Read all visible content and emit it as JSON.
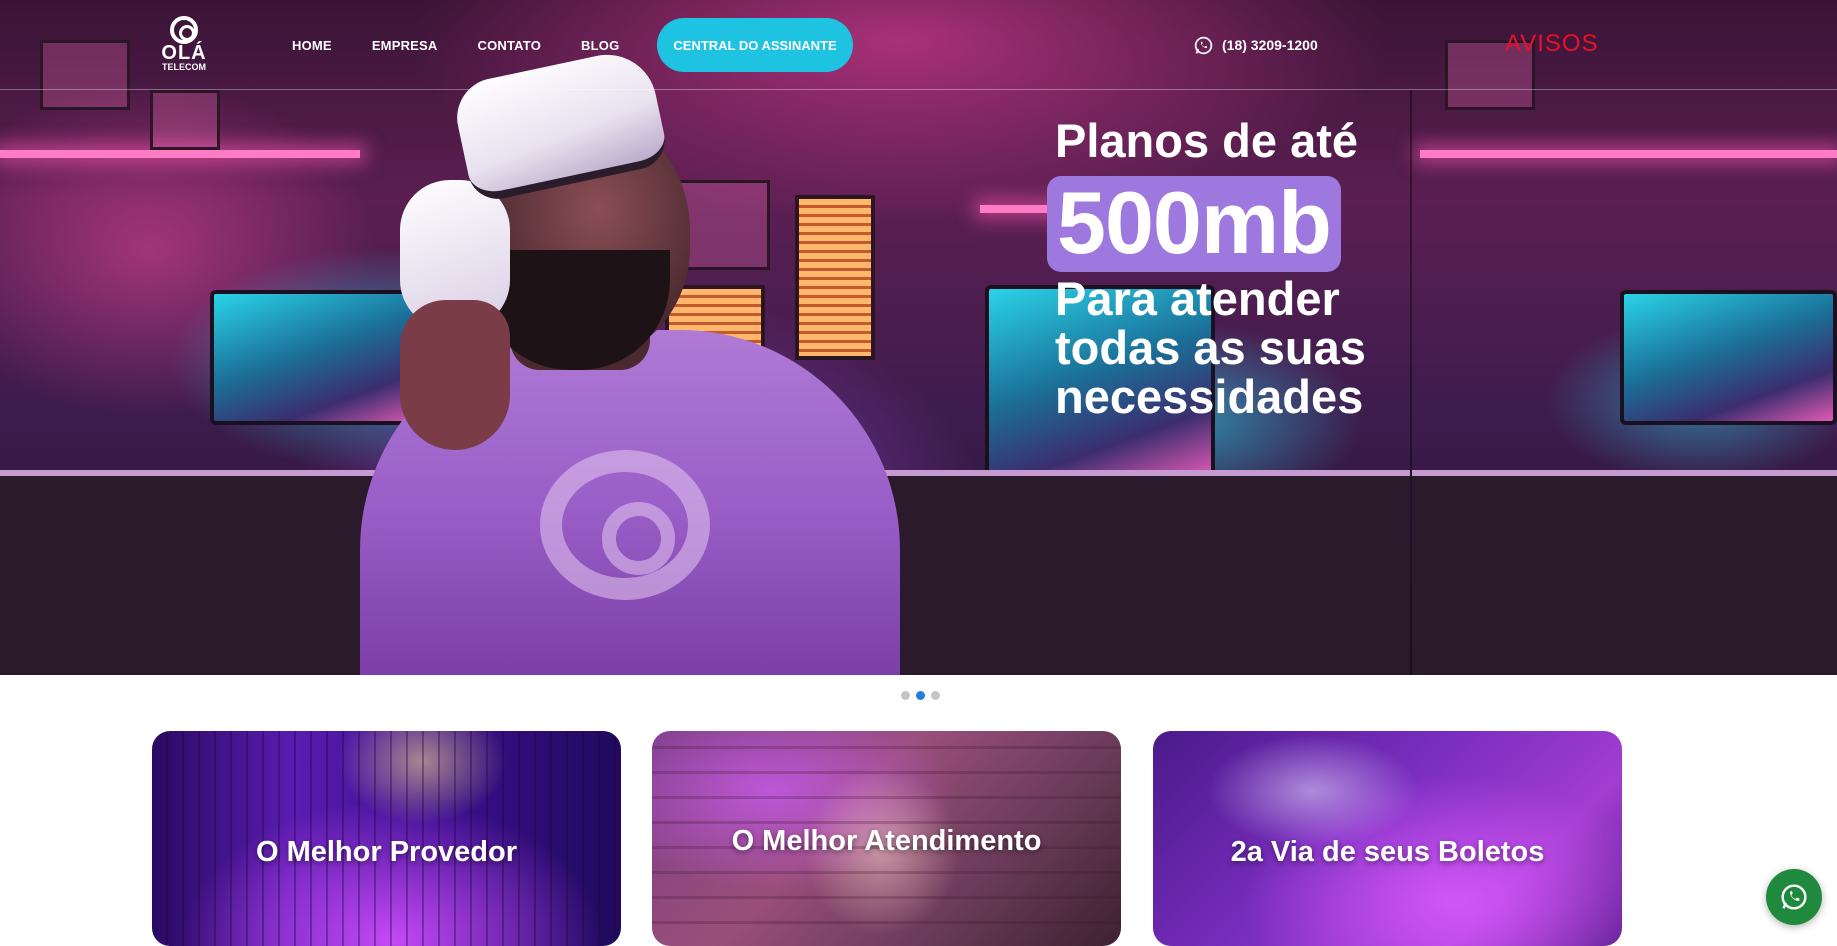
{
  "brand": {
    "logo_main": "OLÁ",
    "logo_sub": "TELECOM"
  },
  "nav": {
    "items": [
      {
        "label": "HOME"
      },
      {
        "label": "EMPRESA"
      },
      {
        "label": "CONTATO"
      },
      {
        "label": "BLOG"
      }
    ],
    "cta_label": "CENTRAL DO ASSINANTE",
    "phone": "(18) 3209-1200",
    "avisos_label": "AVISOS"
  },
  "hero": {
    "line1": "Planos de até",
    "highlight": "500mb",
    "rest": "Para atender todas as suas necessidades"
  },
  "slider": {
    "total_slides": 3,
    "active_slide": 2
  },
  "cards": [
    {
      "title": "O Melhor Provedor"
    },
    {
      "title": "O Melhor Atendimento"
    },
    {
      "title": "2a Via de seus Boletos"
    }
  ],
  "colors": {
    "cta_background": "#1fc3e2",
    "avisos": "#e8112a",
    "hero_highlight": "#9d78de",
    "dot_active": "#1f7ee0",
    "dot_inactive": "#c4c4c4",
    "whatsapp_button": "#1f8a3e"
  },
  "icons": {
    "phone": "whatsapp-icon",
    "floating_button": "whatsapp-icon"
  }
}
